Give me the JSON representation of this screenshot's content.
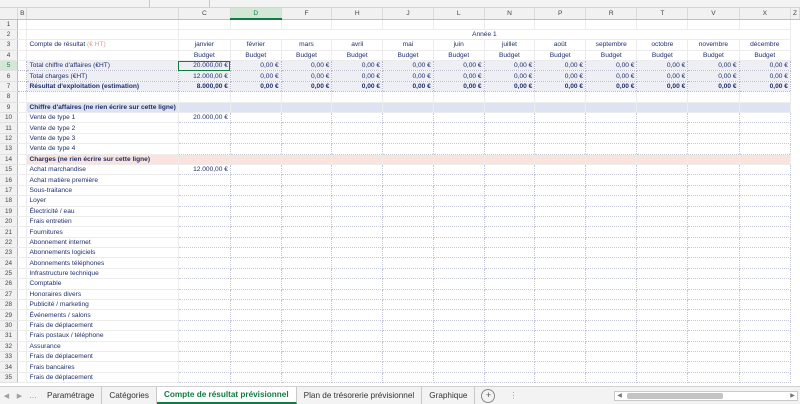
{
  "column_headers": [
    "B",
    "C",
    "D",
    "F",
    "H",
    "J",
    "L",
    "N",
    "P",
    "R",
    "T",
    "V",
    "X",
    "Z"
  ],
  "selected_column": "D",
  "selected_row": "5",
  "sheet": {
    "title": "Compte de résultat",
    "title_unit": "(€ HT)",
    "year_label": "Année 1",
    "months": [
      "janvier",
      "février",
      "mars",
      "avril",
      "mai",
      "juin",
      "juillet",
      "août",
      "septembre",
      "octobre",
      "novembre",
      "décembre"
    ],
    "budget_label": "Budget",
    "totals": [
      {
        "row": "5",
        "label": "Total chiffre d'affaires (€HT)",
        "values": [
          "20.000,00 €",
          "0,00 €",
          "0,00 €",
          "0,00 €",
          "0,00 €",
          "0,00 €",
          "0,00 €",
          "0,00 €",
          "0,00 €",
          "0,00 €",
          "0,00 €",
          "0,00 €"
        ],
        "bold": false
      },
      {
        "row": "6",
        "label": "Total charges (€HT)",
        "values": [
          "12.000,00 €",
          "0,00 €",
          "0,00 €",
          "0,00 €",
          "0,00 €",
          "0,00 €",
          "0,00 €",
          "0,00 €",
          "0,00 €",
          "0,00 €",
          "0,00 €",
          "0,00 €"
        ],
        "bold": false
      },
      {
        "row": "7",
        "label": "Résultat d'exploitation (estimation)",
        "values": [
          "8.000,00 €",
          "0,00 €",
          "0,00 €",
          "0,00 €",
          "0,00 €",
          "0,00 €",
          "0,00 €",
          "0,00 €",
          "0,00 €",
          "0,00 €",
          "0,00 €",
          "0,00 €"
        ],
        "bold": true
      }
    ],
    "sections": [
      {
        "row": "9",
        "label": "Chiffre d'affaires (ne rien écrire sur cette ligne)",
        "style": "sec"
      },
      {
        "row": "14",
        "label": "Charges (ne rien écrire sur cette ligne)",
        "style": "sec2"
      }
    ],
    "lines": [
      {
        "row": "10",
        "label": "Vente de type 1",
        "jan": "20.000,00 €"
      },
      {
        "row": "11",
        "label": "Vente de type 2",
        "jan": ""
      },
      {
        "row": "12",
        "label": "Vente de type 3",
        "jan": ""
      },
      {
        "row": "13",
        "label": "Vente de type 4",
        "jan": ""
      },
      {
        "row": "15",
        "label": "Achat marchandise",
        "jan": "12.000,00 €"
      },
      {
        "row": "16",
        "label": "Achat matière première",
        "jan": ""
      },
      {
        "row": "17",
        "label": "Sous-traitance",
        "jan": ""
      },
      {
        "row": "18",
        "label": "Loyer",
        "jan": ""
      },
      {
        "row": "19",
        "label": "Électricité / eau",
        "jan": ""
      },
      {
        "row": "20",
        "label": "Frais entretien",
        "jan": ""
      },
      {
        "row": "21",
        "label": "Fournitures",
        "jan": ""
      },
      {
        "row": "22",
        "label": "Abonnement internet",
        "jan": ""
      },
      {
        "row": "23",
        "label": "Abonnements logiciels",
        "jan": ""
      },
      {
        "row": "24",
        "label": "Abonnements téléphones",
        "jan": ""
      },
      {
        "row": "25",
        "label": "Infrastructure technique",
        "jan": ""
      },
      {
        "row": "26",
        "label": "Comptable",
        "jan": ""
      },
      {
        "row": "27",
        "label": "Honoraires divers",
        "jan": ""
      },
      {
        "row": "28",
        "label": "Publicité / marketing",
        "jan": ""
      },
      {
        "row": "29",
        "label": "Événements / salons",
        "jan": ""
      },
      {
        "row": "30",
        "label": "Frais de déplacement",
        "jan": ""
      },
      {
        "row": "31",
        "label": "Frais postaux / téléphone",
        "jan": ""
      },
      {
        "row": "32",
        "label": "Assurance",
        "jan": ""
      },
      {
        "row": "33",
        "label": "Frais de déplacement",
        "jan": ""
      },
      {
        "row": "34",
        "label": "Frais bancaires",
        "jan": ""
      },
      {
        "row": "35",
        "label": "Frais de déplacement",
        "jan": ""
      }
    ]
  },
  "tabs": {
    "items": [
      "Paramétrage",
      "Catégories",
      "Compte de résultat prévisionnel",
      "Plan de trésorerie prévisionnel",
      "Graphique"
    ],
    "active": "Compte de résultat prévisionnel",
    "add_label": "+",
    "ellipsis": "…",
    "h_dots": "⋮"
  },
  "icons": {
    "prev": "chevron-left-icon",
    "next": "chevron-right-icon",
    "add": "plus-circle-icon"
  },
  "colors": {
    "accent": "#107c41",
    "label_text": "#1f2f6b",
    "section_revenue": "#dde3f0",
    "section_charges": "#f8e4dd",
    "title_unit": "#e69a8a"
  }
}
